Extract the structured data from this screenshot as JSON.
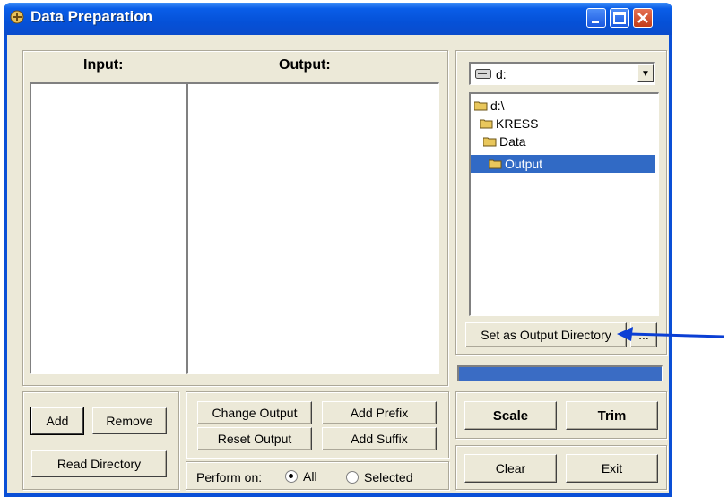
{
  "window": {
    "title": "Data Preparation"
  },
  "lists": {
    "input_label": "Input:",
    "output_label": "Output:"
  },
  "drive": {
    "selected": "d:"
  },
  "tree": {
    "items": [
      {
        "label": "d:\\",
        "selected": false
      },
      {
        "label": "KRESS",
        "selected": false
      },
      {
        "label": "Data",
        "selected": false
      },
      {
        "label": "Output",
        "selected": true
      }
    ]
  },
  "buttons": {
    "set_output": "Set as Output Directory",
    "more": "...",
    "add": "Add",
    "remove": "Remove",
    "read_directory": "Read Directory",
    "change_output": "Change Output",
    "add_prefix": "Add Prefix",
    "reset_output": "Reset Output",
    "add_suffix": "Add Suffix",
    "scale": "Scale",
    "trim": "Trim",
    "clear": "Clear",
    "exit": "Exit"
  },
  "perform_on": {
    "label": "Perform on:",
    "options": [
      {
        "label": "All",
        "checked": true
      },
      {
        "label": "Selected",
        "checked": false
      }
    ]
  },
  "progress": {
    "fraction": 1.0
  },
  "colors": {
    "arrow": "#0b3fd4",
    "selection": "#316ac5",
    "titlebar": "#0a4fd6"
  }
}
